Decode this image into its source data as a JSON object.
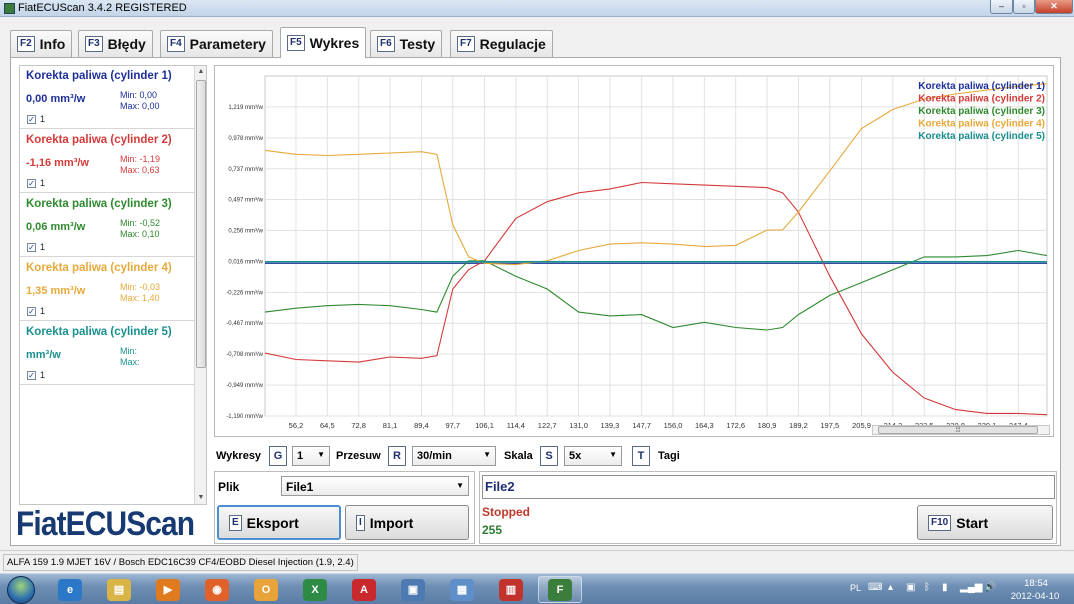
{
  "window": {
    "title": "FiatECUScan 3.4.2 REGISTERED",
    "min_glyph": "–",
    "max_glyph": "▫",
    "close_glyph": "✕"
  },
  "tabs": [
    {
      "key": "F2",
      "label": "Info"
    },
    {
      "key": "F3",
      "label": "Błędy"
    },
    {
      "key": "F4",
      "label": "Parametery"
    },
    {
      "key": "F5",
      "label": "Wykres"
    },
    {
      "key": "F6",
      "label": "Testy"
    },
    {
      "key": "F7",
      "label": "Regulacje"
    }
  ],
  "active_tab": "Wykres",
  "pids": [
    {
      "name": "Korekta paliwa (cylinder 1)",
      "value": "0,00 mm³/w",
      "min": "Min: 0,00",
      "max": "Max: 0,00",
      "count": "1",
      "color": "#1f2f9a"
    },
    {
      "name": "Korekta paliwa (cylinder 2)",
      "value": "-1,16 mm³/w",
      "min": "Min: -1,19",
      "max": "Max: 0,63",
      "count": "1",
      "color": "#d43a3a"
    },
    {
      "name": "Korekta paliwa (cylinder 3)",
      "value": "0,06 mm³/w",
      "min": "Min: -0,52",
      "max": "Max: 0,10",
      "count": "1",
      "color": "#2f8a2f"
    },
    {
      "name": "Korekta paliwa (cylinder 4)",
      "value": "1,35 mm³/w",
      "min": "Min: -0,03",
      "max": "Max: 1,40",
      "count": "1",
      "color": "#e6a93a"
    },
    {
      "name": "Korekta paliwa (cylinder 5)",
      "value": "mm³/w",
      "min": "Min:",
      "max": "Max:",
      "count": "1",
      "color": "#1a8f8f"
    }
  ],
  "logo": "FiatECUScan",
  "chart_data": {
    "type": "line",
    "title": "",
    "xlabel": "",
    "ylabel": "",
    "x_ticks": [
      "56,2",
      "64,5",
      "72,8",
      "81,1",
      "89,4",
      "97,7",
      "106,1",
      "114,4",
      "122,7",
      "131,0",
      "139,3",
      "147,7",
      "156,0",
      "164,3",
      "172,6",
      "180,9",
      "189,2",
      "197,5",
      "205,9",
      "214,2",
      "222,5",
      "230,8",
      "239,1",
      "247,4"
    ],
    "y_ticks": [
      "1,219 mm³/w",
      "0,978 mm³/w",
      "0,737 mm³/w",
      "0,497 mm³/w",
      "0,256 mm³/w",
      "0,016 mm³/w",
      "-0,226 mm³/w",
      "-0,467 mm³/w",
      "-0,708 mm³/w",
      "-0,949 mm³/w",
      "-1,190 mm³/w"
    ],
    "xlim": [
      48.0,
      255.0
    ],
    "ylim": [
      -1.19,
      1.46
    ],
    "grid": true,
    "legend": "top-right",
    "x": [
      48,
      56.2,
      64.5,
      72.8,
      81.1,
      89.4,
      93.5,
      97.7,
      101.9,
      106.1,
      114.4,
      122.7,
      131.0,
      139.3,
      147.7,
      156.0,
      164.3,
      172.6,
      180.9,
      185,
      189.2,
      197.5,
      205.9,
      214.2,
      222.5,
      230.8,
      239.1,
      247.4,
      255
    ],
    "series": [
      {
        "name": "Korekta paliwa (cylinder 1)",
        "color": "#1f2f9a",
        "values": [
          0,
          0,
          0,
          0,
          0,
          0,
          0,
          0,
          0,
          0,
          0,
          0,
          0,
          0,
          0,
          0,
          0,
          0,
          0,
          0,
          0,
          0,
          0,
          0,
          0,
          0,
          0,
          0,
          0
        ]
      },
      {
        "name": "Korekta paliwa (cylinder 2)",
        "color": "#d43a3a",
        "values": [
          -0.7,
          -0.75,
          -0.76,
          -0.77,
          -0.73,
          -0.74,
          -0.72,
          -0.2,
          -0.05,
          0.02,
          0.35,
          0.48,
          0.55,
          0.58,
          0.63,
          0.62,
          0.61,
          0.6,
          0.59,
          0.55,
          0.4,
          -0.1,
          -0.55,
          -0.85,
          -1.05,
          -1.14,
          -1.17,
          -1.17,
          -1.18
        ]
      },
      {
        "name": "Korekta paliwa (cylinder 3)",
        "color": "#2f8a2f",
        "values": [
          -0.38,
          -0.35,
          -0.33,
          -0.32,
          -0.33,
          -0.36,
          -0.38,
          -0.1,
          0.02,
          0.02,
          -0.1,
          -0.2,
          -0.38,
          -0.41,
          -0.4,
          -0.5,
          -0.46,
          -0.5,
          -0.52,
          -0.5,
          -0.4,
          -0.25,
          -0.15,
          -0.05,
          0.05,
          0.05,
          0.06,
          0.1,
          0.06
        ]
      },
      {
        "name": "Korekta paliwa (cylinder 4)",
        "color": "#e6a93a",
        "values": [
          0.88,
          0.85,
          0.84,
          0.85,
          0.86,
          0.87,
          0.85,
          0.3,
          0.05,
          0.0,
          -0.01,
          0.02,
          0.1,
          0.15,
          0.16,
          0.15,
          0.13,
          0.14,
          0.26,
          0.26,
          0.4,
          0.72,
          1.05,
          1.2,
          1.28,
          1.32,
          1.35,
          1.38,
          1.4
        ]
      },
      {
        "name": "Korekta paliwa (cylinder 5)",
        "color": "#1a8f8f",
        "values": [
          0.012,
          0.012,
          0.012,
          0.012,
          0.012,
          0.012,
          0.012,
          0.012,
          0.012,
          0.012,
          0.012,
          0.012,
          0.012,
          0.012,
          0.012,
          0.012,
          0.012,
          0.012,
          0.012,
          0.012,
          0.012,
          0.012,
          0.012,
          0.012,
          0.012,
          0.012,
          0.012,
          0.012,
          0.012
        ]
      }
    ]
  },
  "hscroll_glyph": "⦙⦙⦙",
  "controls": {
    "wykresy_label": "Wykresy",
    "wykresy_key": "G",
    "wykresy_value": "1",
    "przesuw_label": "Przesuw",
    "przesuw_key": "R",
    "przesuw_value": "30/min",
    "skala_label": "Skala",
    "skala_key": "S",
    "skala_value": "5x",
    "tagi_key": "T",
    "tagi_label": "Tagi"
  },
  "file": {
    "label": "Plik",
    "value": "File1"
  },
  "eksport": {
    "key": "E",
    "label": "Eksport"
  },
  "import": {
    "key": "I",
    "label": "Import"
  },
  "session": {
    "file": "File2",
    "state": "Stopped",
    "count": "255"
  },
  "start": {
    "key": "F10",
    "label": "Start"
  },
  "statusbar": {
    "text": "ALFA 159 1.9 MJET 16V / Bosch EDC16C39 CF4/EOBD Diesel Injection (1.9, 2.4)"
  },
  "taskbar": {
    "lang": "PL",
    "time": "18:54",
    "date": "2012-04-10",
    "apps": [
      {
        "name": "ie-icon",
        "color": "#2b78c9",
        "glyph": "e",
        "open": false
      },
      {
        "name": "explorer-icon",
        "color": "#d9b548",
        "glyph": "▤",
        "open": false
      },
      {
        "name": "media-player-icon",
        "color": "#e07a1f",
        "glyph": "▶",
        "open": false
      },
      {
        "name": "firefox-icon",
        "color": "#e0622a",
        "glyph": "◉",
        "open": false
      },
      {
        "name": "outlook-icon",
        "color": "#e8a33a",
        "glyph": "O",
        "open": false
      },
      {
        "name": "excel-icon",
        "color": "#2e8b45",
        "glyph": "X",
        "open": false
      },
      {
        "name": "acrobat-icon",
        "color": "#c9282d",
        "glyph": "A",
        "open": false
      },
      {
        "name": "screen-icon",
        "color": "#4d7ab0",
        "glyph": "▣",
        "open": false
      },
      {
        "name": "network-icon",
        "color": "#5e8fc9",
        "glyph": "▦",
        "open": false
      },
      {
        "name": "toolbox-icon",
        "color": "#c2332e",
        "glyph": "▥",
        "open": false
      },
      {
        "name": "fiatecuscan-icon",
        "color": "#3b7d3b",
        "glyph": "F",
        "open": true
      }
    ]
  }
}
